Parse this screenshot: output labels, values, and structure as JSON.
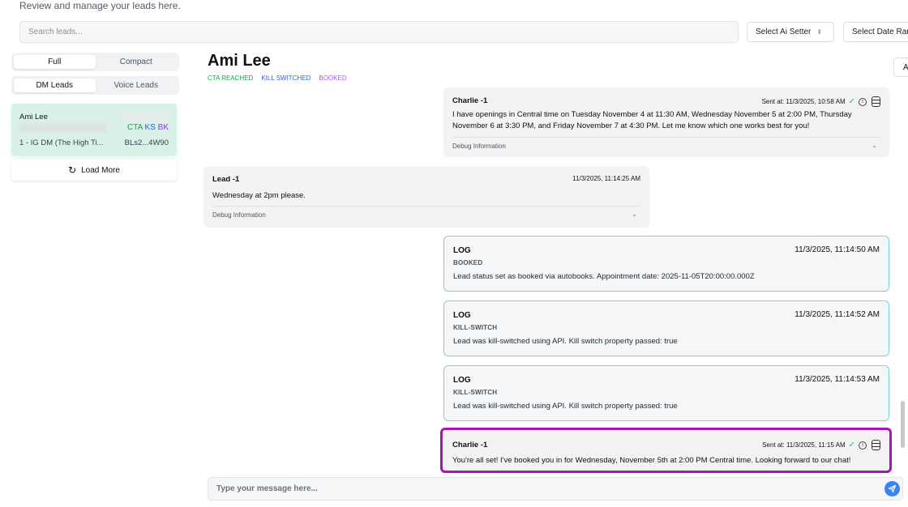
{
  "header": {
    "subtitle": "Review and manage your leads here."
  },
  "search": {
    "placeholder": "Search leads..."
  },
  "filters": {
    "ai_setter_label": "Select Ai Setter",
    "date_range_label": "Select Date Ran"
  },
  "sidebar": {
    "view_options": [
      "Full",
      "Compact"
    ],
    "view_selected": "Full",
    "lead_types": [
      "DM Leads",
      "Voice Leads"
    ],
    "lead_type_selected": "DM Leads",
    "leads": [
      {
        "name": "Ami Lee",
        "tags": {
          "cta": "CTA",
          "ks": "KS",
          "bk": "BK"
        },
        "source": "1 - IG DM (The High Ti...",
        "id": "BLs2...4W90"
      }
    ],
    "load_more_label": "Load More"
  },
  "conversation": {
    "contact_name": "Ami Lee",
    "status_tags": {
      "cta": "CTA REACHED",
      "ks": "KILL SWITCHED",
      "bk": "BOOKED"
    },
    "top_button_label": "A",
    "messages": [
      {
        "sender": "Charlie -1",
        "meta": "Sent at: 11/3/2025, 10:58 AM",
        "text": "I have openings in Central time on Tuesday November 4 at 11:30 AM, Wednesday November 5 at 2:00 PM, Thursday November 6 at 3:30 PM, and Friday November 7 at 4:30 PM. Let me know which one works best for you!",
        "debug_label": "Debug Information"
      },
      {
        "sender": "Lead -1",
        "meta": "11/3/2025, 11:14:25 AM",
        "text": "Wednesday at 2pm please.",
        "debug_label": "Debug Information"
      },
      {
        "title": "LOG",
        "time": "11/3/2025, 11:14:50 AM",
        "type": "BOOKED",
        "text": "Lead status set as booked via autobooks. Appointment date: 2025-11-05T20:00:00.000Z"
      },
      {
        "title": "LOG",
        "time": "11/3/2025, 11:14:52 AM",
        "type": "KILL-SWITCH",
        "text": "Lead was kill-switched using API. Kill switch property passed: true"
      },
      {
        "title": "LOG",
        "time": "11/3/2025, 11:14:53 AM",
        "type": "KILL-SWITCH",
        "text": "Lead was kill-switched using API. Kill switch property passed: true"
      },
      {
        "sender": "Charlie -1",
        "meta": "Sent at: 11/3/2025, 11:15 AM",
        "text": "You're all set! I've booked you in for Wednesday, November 5th at 2:00 PM Central time. Looking forward to our chat!"
      }
    ]
  },
  "composer": {
    "placeholder": "Type your message here..."
  },
  "colors": {
    "accent_highlight": "#a613b6",
    "log_border": "#7dd3dc",
    "selected_lead_bg": "#d9f1e9",
    "send_button": "#3b82f6",
    "tag_cta": "#16a34a",
    "tag_ks": "#2563eb",
    "tag_bk": "#a855f7"
  },
  "icons": {
    "refresh": "refresh-icon",
    "sort": "sort-icon",
    "check": "check-icon",
    "info": "info-icon",
    "database": "database-icon",
    "chevron": "chevron-down-icon",
    "send": "send-icon"
  }
}
